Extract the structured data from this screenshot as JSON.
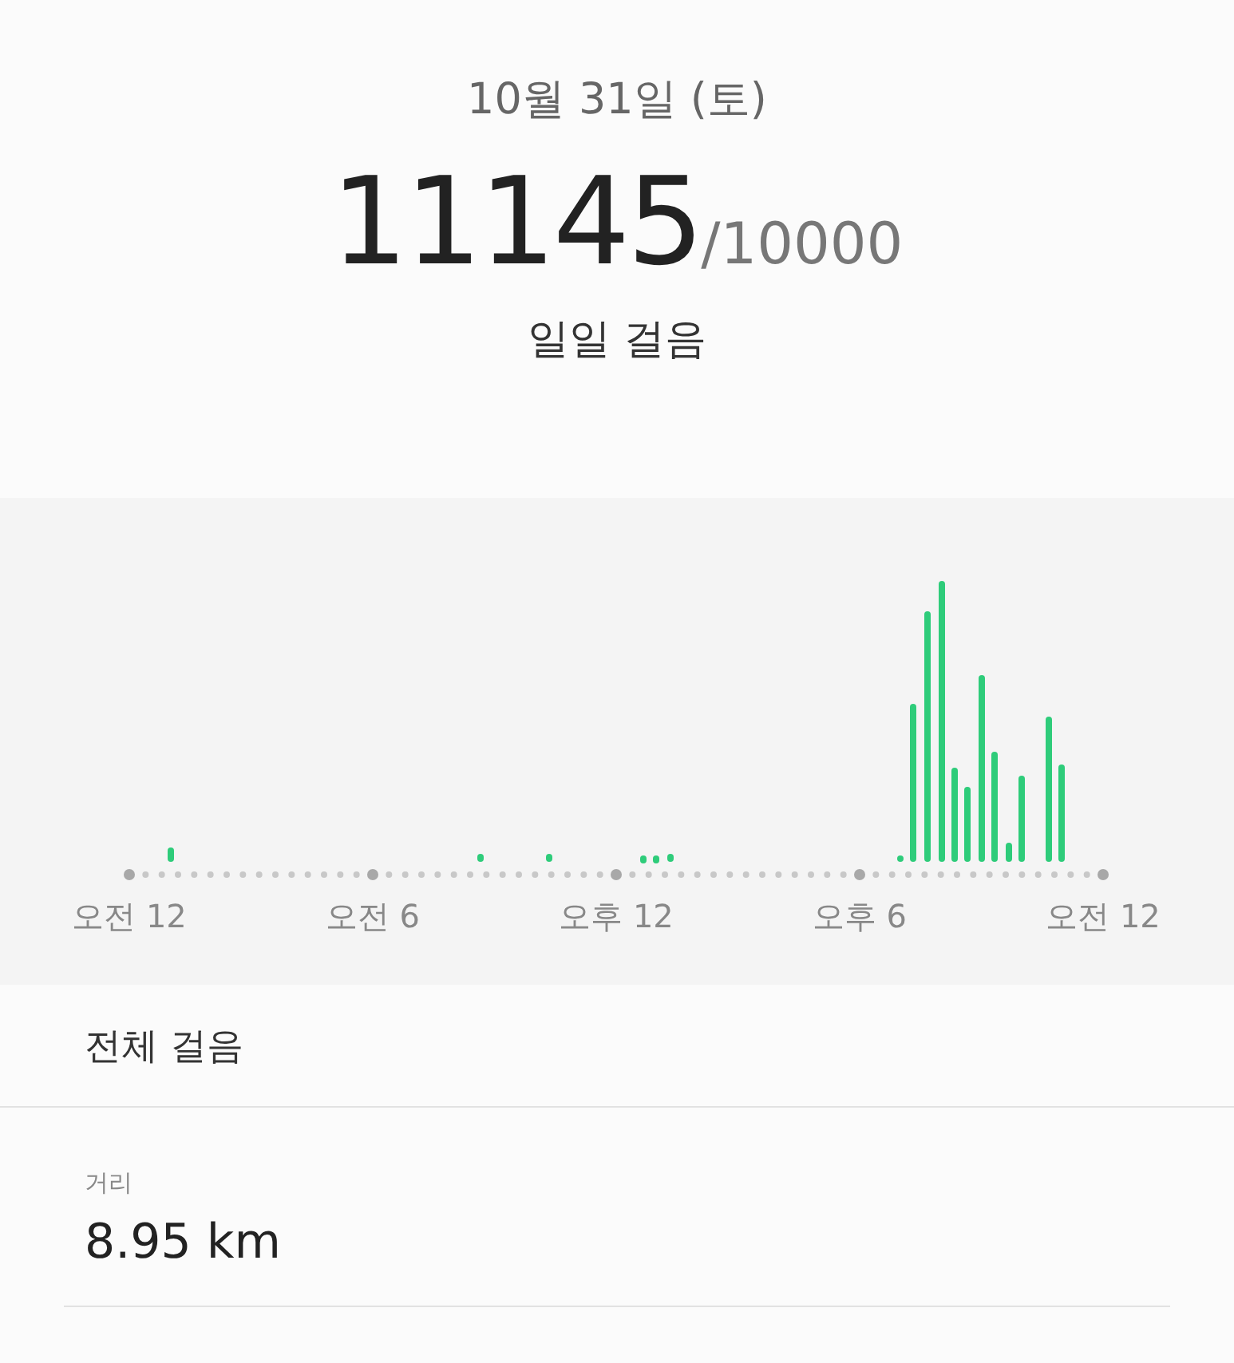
{
  "header": {
    "date": "10월 31일 (토)",
    "steps": "11145",
    "goal": "/10000",
    "label": "일일 걸음"
  },
  "chart": {
    "x_labels": [
      "오전 12",
      "오전 6",
      "오후 12",
      "오후 6",
      "오전 12"
    ]
  },
  "section_title": "전체 걸음",
  "stats": [
    {
      "label": "거리",
      "value": "8.95 km"
    }
  ]
}
